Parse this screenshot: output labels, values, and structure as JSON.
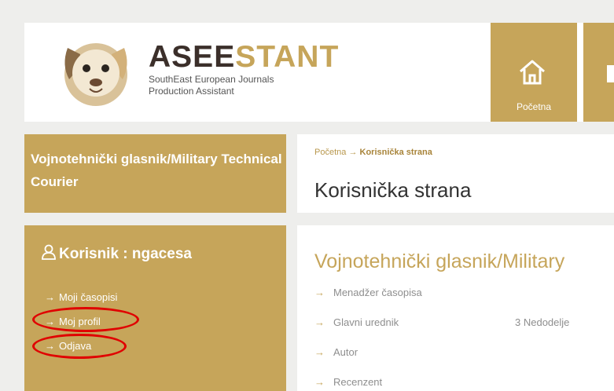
{
  "header": {
    "logo_title_dark": "ASEE",
    "logo_title_light": "STANT",
    "logo_sub_line1": "SouthEast European Journals",
    "logo_sub_line2": "Production Assistant",
    "nav_home_label": "Početna"
  },
  "sidebar": {
    "journal_title": "Vojnotehnički glasnik/Military Technical Courier",
    "user_title": "Korisnik : ngacesa",
    "menu": [
      {
        "label": "Moji časopisi"
      },
      {
        "label": "Moj profil"
      },
      {
        "label": "Odjava"
      }
    ]
  },
  "breadcrumb": {
    "home": "Početna",
    "current": "Korisnička strana"
  },
  "page": {
    "title": "Korisnička strana",
    "journal_heading": "Vojnotehnički glasnik/Military",
    "roles": [
      {
        "label": "Menadžer časopisa",
        "extra": ""
      },
      {
        "label": "Glavni urednik",
        "extra": "3 Nedodelje"
      },
      {
        "label": "Autor",
        "extra": ""
      },
      {
        "label": "Recenzent",
        "extra": ""
      }
    ]
  },
  "colors": {
    "accent": "#c6a55a",
    "annotation": "#e00000"
  }
}
